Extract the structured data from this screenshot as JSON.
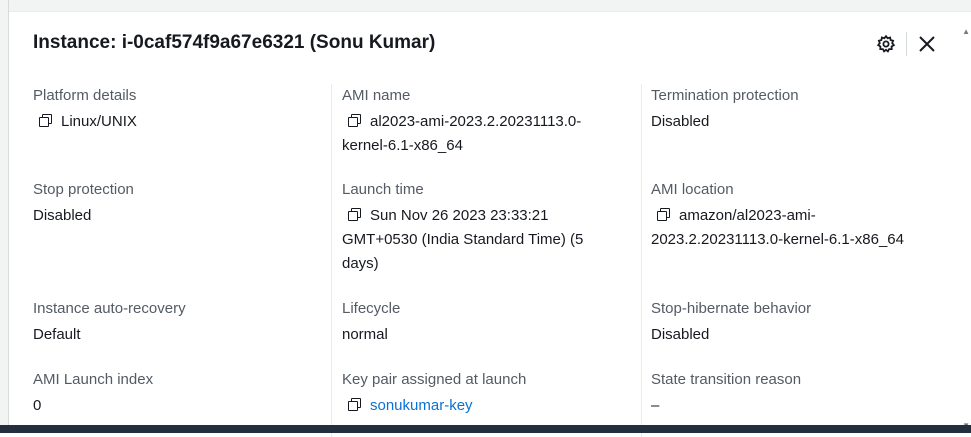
{
  "header": {
    "title": "Instance: i-0caf574f9a67e6321 (Sonu Kumar)",
    "drag_handle": "=",
    "icons": [
      "gear-icon",
      "close-icon"
    ]
  },
  "fields": {
    "platform_details": {
      "label": "Platform details",
      "value": "Linux/UNIX"
    },
    "ami_name": {
      "label": "AMI name",
      "value_line1": "al2023-ami-2023.2.20231113.0-",
      "value_line2": "kernel-6.1-x86_64"
    },
    "termination_protection": {
      "label": "Termination protection",
      "value": "Disabled"
    },
    "stop_protection": {
      "label": "Stop protection",
      "value": "Disabled"
    },
    "launch_time": {
      "label": "Launch time",
      "value_line1": "Sun Nov 26 2023 23:33:21",
      "value_line2": "GMT+0530 (India Standard Time) (5",
      "value_line3": "days)"
    },
    "ami_location": {
      "label": "AMI location",
      "value_line1": "amazon/al2023-ami-",
      "value_line2": "2023.2.20231113.0-kernel-6.1-x86_64"
    },
    "instance_auto_recovery": {
      "label": "Instance auto-recovery",
      "value": "Default"
    },
    "lifecycle": {
      "label": "Lifecycle",
      "value": "normal"
    },
    "stop_hibernate_behavior": {
      "label": "Stop-hibernate behavior",
      "value": "Disabled"
    },
    "ami_launch_index": {
      "label": "AMI Launch index",
      "value": "0"
    },
    "key_pair": {
      "label": "Key pair assigned at launch",
      "value": "sonukumar-key"
    },
    "state_transition_reason": {
      "label": "State transition reason",
      "value": "–"
    }
  },
  "colors": {
    "link": "#0972d3",
    "label": "#545b64",
    "text": "#16191f",
    "bottom_bar": "#232f3e"
  }
}
